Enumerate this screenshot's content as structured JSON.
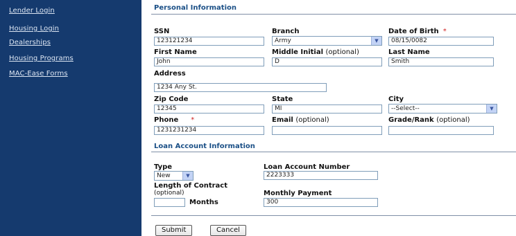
{
  "sidebar": {
    "items": [
      {
        "label": "Lender Login"
      },
      {
        "label": "Housing Login"
      },
      {
        "label": "Dealerships"
      },
      {
        "label": "Housing Programs"
      },
      {
        "label": "MAC-Ease Forms"
      }
    ]
  },
  "personal": {
    "title": "Personal Information",
    "ssn": {
      "label": "SSN",
      "value": "123121234"
    },
    "branch": {
      "label": "Branch",
      "value": "Army"
    },
    "dob": {
      "label": "Date of Birth",
      "required": "*",
      "value": "08/15/0082"
    },
    "first_name": {
      "label": "First Name",
      "value": "John"
    },
    "middle_initial": {
      "label": "Middle Initial",
      "optional": "(optional)",
      "value": "D"
    },
    "last_name": {
      "label": "Last Name",
      "value": "Smith"
    },
    "address": {
      "label": "Address",
      "value": "1234 Any St."
    },
    "zip": {
      "label": "Zip Code",
      "value": "12345"
    },
    "state": {
      "label": "State",
      "value": "MI"
    },
    "city": {
      "label": "City",
      "value": "--Select--"
    },
    "phone": {
      "label": "Phone",
      "required": "*",
      "value": "1231231234"
    },
    "email": {
      "label": "Email",
      "optional": "(optional)",
      "value": ""
    },
    "grade": {
      "label": "Grade/Rank",
      "optional": "(optional)",
      "value": ""
    }
  },
  "loan": {
    "title": "Loan Account Information",
    "type": {
      "label": "Type",
      "value": "New"
    },
    "account_number": {
      "label": "Loan Account Number",
      "value": "2223333"
    },
    "length": {
      "label": "Length of Contract",
      "optional": "(optional)",
      "value": "",
      "unit": "Months"
    },
    "monthly_payment": {
      "label": "Monthly Payment",
      "value": "300"
    }
  },
  "actions": {
    "submit": "Submit",
    "cancel": "Cancel"
  },
  "colors": {
    "sidebar": "#153a6e",
    "section_title": "#1a4f86",
    "required": "#d02020"
  }
}
